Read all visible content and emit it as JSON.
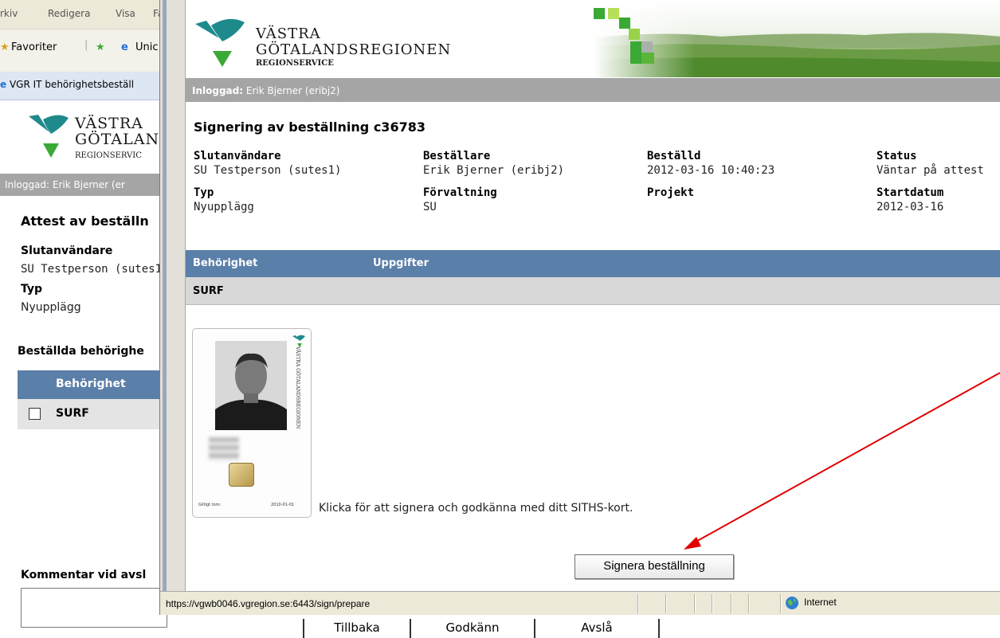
{
  "background_window": {
    "menu": [
      "rkiv",
      "Redigera",
      "Visa",
      "Fa"
    ],
    "favorites_label": "Favoriter",
    "fav_link": "Unic",
    "tab_title": "VGR IT behörighetsbeställ",
    "logo_line1": "VÄSTRA",
    "logo_line2": "GÖTALAN",
    "logo_line3": "REGIONSERVIC",
    "logged_in": "Inloggad: Erik Bjerner (er",
    "heading": "Attest av beställn",
    "end_user_label": "Slutanvändare",
    "end_user_value": "SU Testperson (sutes1",
    "type_label": "Typ",
    "type_value": "Nyupplägg",
    "ordered_permissions_heading": "Beställda behörighe",
    "table_header": "Behörighet",
    "table_row": "SURF",
    "comment_label": "Kommentar vid avsl",
    "buttons": [
      "Tillbaka",
      "Godkänn",
      "Avslå"
    ]
  },
  "popup": {
    "logo_line1": "VÄSTRA",
    "logo_line2": "GÖTALANDSREGIONEN",
    "logo_line3": "REGIONSERVICE",
    "logged_in_label": "Inloggad:",
    "logged_in_user": "Erik Bjerner (eribj2)",
    "title": "Signering av beställning c36783",
    "fields": {
      "end_user_label": "Slutanvändare",
      "end_user_value": "SU Testperson (sutes1)",
      "orderer_label": "Beställare",
      "orderer_value": "Erik Bjerner (eribj2)",
      "ordered_label": "Beställd",
      "ordered_value": "2012-03-16 10:40:23",
      "status_label": "Status",
      "status_value": "Väntar på attest",
      "type_label": "Typ",
      "type_value": "Nyupplägg",
      "administration_label": "Förvaltning",
      "administration_value": "SU",
      "project_label": "Projekt",
      "startdate_label": "Startdatum",
      "startdate_value": "2012-03-16"
    },
    "table": {
      "col1": "Behörighet",
      "col2": "Uppgifter",
      "row": "SURF"
    },
    "card": {
      "valid_label": "Giltigt tom:",
      "valid_date": "2010-01-01",
      "vertical_text": "VÄSTRA GÖTALANDSREGIONEN"
    },
    "sign_instruction": "Klicka för att signera och godkänna med ditt SITHS-kort.",
    "sign_button": "Signera beställning",
    "status_url": "https://vgwb0046.vgregion.se:6443/sign/prepare",
    "status_zone": "Internet"
  },
  "colors": {
    "header_blue": "#5a7fa8",
    "logged_bar_gray": "#a5a5a5",
    "logo_teal": "#1f8a8c",
    "logo_green": "#3aa935",
    "arrow_red": "#e00000"
  },
  "icons": [
    "ie-icon",
    "star-icon",
    "globe-icon",
    "logo-mark-icon",
    "chip-icon"
  ]
}
